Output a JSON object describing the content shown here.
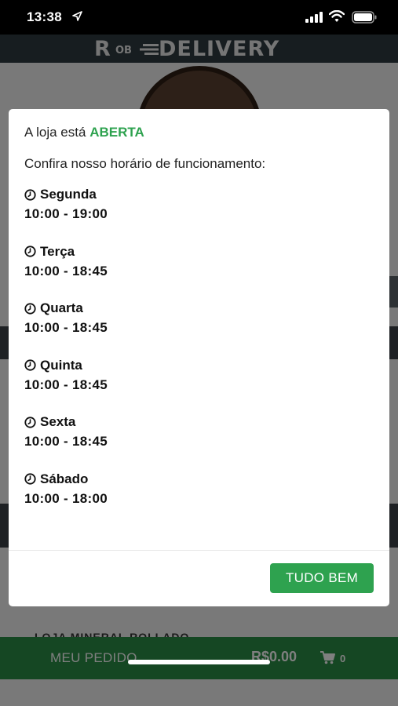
{
  "status_bar": {
    "time": "13:38"
  },
  "app": {
    "logo_prefix": "R",
    "logo_small": "OB",
    "logo_text": "DELIVERY",
    "background_list_text": "LOJA MINERAL ROLLADO",
    "bottom_bar": {
      "label": "MEU PEDIDO",
      "total": "R$0.00",
      "cart_count": "0"
    }
  },
  "modal": {
    "status_prefix": "A loja está",
    "status_value": "ABERTA",
    "intro": "Confira nosso horário de funcionamento:",
    "schedule": [
      {
        "day": "Segunda",
        "hours": "10:00 - 19:00"
      },
      {
        "day": "Terça",
        "hours": "10:00 - 18:45"
      },
      {
        "day": "Quarta",
        "hours": "10:00 - 18:45"
      },
      {
        "day": "Quinta",
        "hours": "10:00 - 18:45"
      },
      {
        "day": "Sexta",
        "hours": "10:00 - 18:45"
      },
      {
        "day": "Sábado",
        "hours": "10:00 - 18:00"
      }
    ],
    "confirm_button": "TUDO BEM"
  },
  "colors": {
    "accent_green": "#2ea24f",
    "bottom_bar_green": "#2a8f47",
    "header_dark": "#2f3a40"
  },
  "icons": [
    "location-arrow-icon",
    "signal-icon",
    "wifi-icon",
    "battery-icon",
    "clock-icon",
    "cart-icon"
  ]
}
